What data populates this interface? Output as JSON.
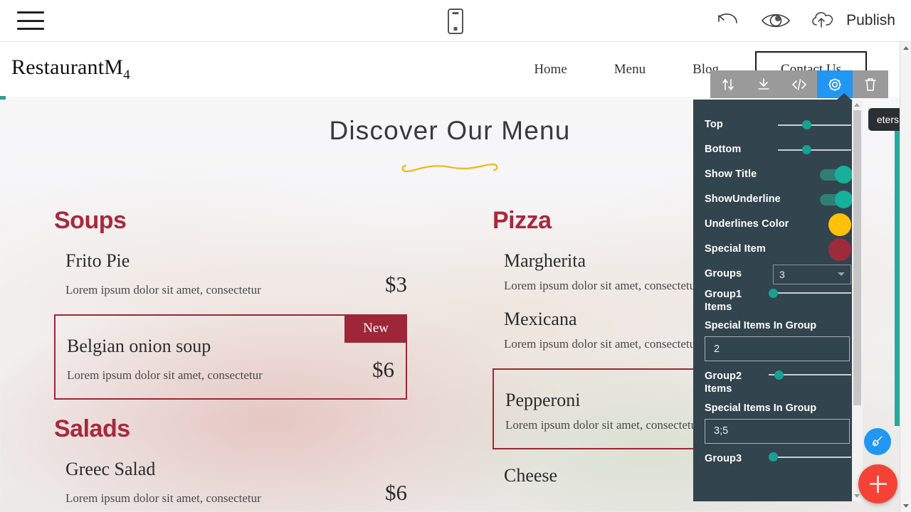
{
  "editor": {
    "menu_icon": "hamburger-menu-icon",
    "preview_device_icon": "mobile-preview-icon",
    "undo_icon": "undo-icon",
    "preview_icon": "eye-preview-icon",
    "publish_icon": "cloud-upload-icon",
    "publish_label": "Publish"
  },
  "element_toolbar": {
    "move_label": "move-updown",
    "download_label": "download",
    "code_label": "code",
    "settings_label": "settings",
    "delete_label": "delete"
  },
  "tooltip": {
    "text": "eters"
  },
  "site": {
    "brand": "RestaurantM",
    "brand_sub": "4",
    "nav": [
      {
        "label": "Home"
      },
      {
        "label": "Menu"
      },
      {
        "label": "Blog"
      }
    ],
    "cta": "Contact Us"
  },
  "menu": {
    "title": "Discover Our Menu",
    "columns": [
      {
        "groups": [
          {
            "title": "Soups",
            "items": [
              {
                "name": "Frito Pie",
                "desc": "Lorem ipsum dolor sit amet, consectetur",
                "price": "$3",
                "special": false,
                "badge": ""
              },
              {
                "name": "Belgian onion soup",
                "desc": "Lorem ipsum dolor sit amet, consectetur",
                "price": "$6",
                "special": true,
                "badge": "New"
              }
            ]
          },
          {
            "title": "Salads",
            "items": [
              {
                "name": "Greec Salad",
                "desc": "Lorem ipsum dolor sit amet, consectetur",
                "price": "$6",
                "special": false,
                "badge": ""
              }
            ]
          }
        ]
      },
      {
        "groups": [
          {
            "title": "Pizza",
            "items": [
              {
                "name": "Margherita",
                "desc": "Lorem ipsum dolor sit amet, consectetur",
                "price": "",
                "special": false,
                "badge": ""
              },
              {
                "name": "Mexicana",
                "desc": "Lorem ipsum dolor sit amet, consectetur",
                "price": "",
                "special": false,
                "badge": ""
              },
              {
                "name": "Pepperoni",
                "desc": "Lorem ipsum dolor sit amet, consectetu",
                "price": "",
                "special": true,
                "badge": ""
              },
              {
                "name": "Cheese",
                "desc": "",
                "price": "",
                "special": false,
                "badge": ""
              }
            ]
          }
        ]
      }
    ]
  },
  "settings_panel": {
    "rows": [
      {
        "type": "slider",
        "label": "Top",
        "value": 33
      },
      {
        "type": "slider",
        "label": "Bottom",
        "value": 33
      },
      {
        "type": "toggle",
        "label": "Show Title",
        "value": "on"
      },
      {
        "type": "toggle",
        "label": "ShowUnderline",
        "value": "on"
      },
      {
        "type": "color",
        "label": "Underlines Color",
        "value": "#ffc107"
      },
      {
        "type": "color",
        "label": "Special Item",
        "value": "#9e2b3c"
      },
      {
        "type": "select",
        "label": "Groups",
        "value": "3"
      },
      {
        "type": "slider",
        "label": "Group1 Items",
        "value": 2
      },
      {
        "type": "text",
        "label": "Special Items In Group",
        "value": "2"
      },
      {
        "type": "slider",
        "label": "Group2 Items",
        "value": 8
      },
      {
        "type": "text",
        "label": "Special Items In Group",
        "value": "3;5"
      },
      {
        "type": "slider",
        "label": "Group3",
        "value": 8
      }
    ],
    "bg_color": "#32444e",
    "accent_color": "#16a191"
  },
  "fabs": {
    "brush_icon": "paint-brush-icon",
    "add_icon": "add-plus-icon"
  }
}
